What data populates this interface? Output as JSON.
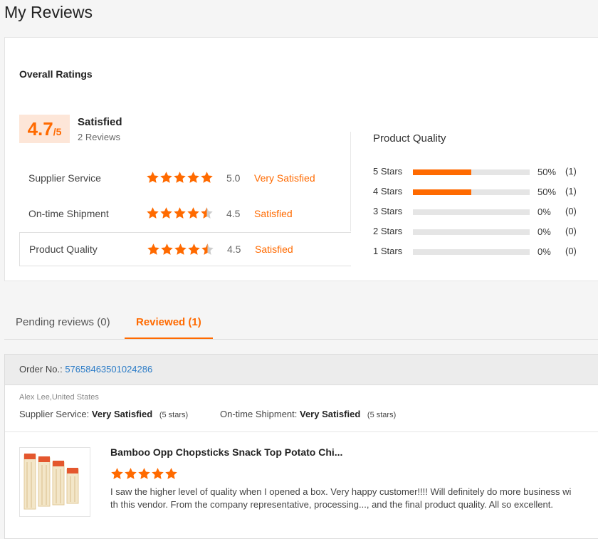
{
  "page": {
    "title": "My Reviews"
  },
  "overall": {
    "section_title": "Overall Ratings",
    "score": "4.7",
    "score_suffix": "/5",
    "summary_label": "Satisfied",
    "review_count": "2 Reviews"
  },
  "ratings": [
    {
      "label": "Supplier Service",
      "score": "5.0",
      "stars": 5.0,
      "verdict": "Very Satisfied"
    },
    {
      "label": "On-time Shipment",
      "score": "4.5",
      "stars": 4.5,
      "verdict": "Satisfied"
    },
    {
      "label": "Product Quality",
      "score": "4.5",
      "stars": 4.5,
      "verdict": "Satisfied"
    }
  ],
  "product_quality": {
    "title": "Product Quality",
    "distribution": [
      {
        "label": "5  Stars",
        "fraction": 0.5,
        "pct": "50%",
        "count": "(1)"
      },
      {
        "label": "4  Stars",
        "fraction": 0.5,
        "pct": "50%",
        "count": "(1)"
      },
      {
        "label": "3  Stars",
        "fraction": 0,
        "pct": "0%",
        "count": "(0)"
      },
      {
        "label": "2  Stars",
        "fraction": 0,
        "pct": "0%",
        "count": "(0)"
      },
      {
        "label": "1  Stars",
        "fraction": 0,
        "pct": "0%",
        "count": "(0)"
      }
    ]
  },
  "tabs": {
    "pending": "Pending reviews (0)",
    "reviewed": "Reviewed (1)"
  },
  "order": {
    "order_label": "Order No.:",
    "order_number": "57658463501024286",
    "reviewer": "Alex Lee,United States",
    "supplier_service_label": "Supplier Service:",
    "supplier_service_value": "Very Satisfied",
    "supplier_service_stars": "(5 stars)",
    "shipment_label": "On-time Shipment:",
    "shipment_value": "Very Satisfied",
    "shipment_stars": "(5 stars)",
    "product_name": "Bamboo Opp Chopsticks Snack Top Potato Chi...",
    "product_rating": 5,
    "review_text": "I saw the higher level of quality when I opened a box.  Very happy customer!!!! Will definitely do more business with this vendor.  From the company representative, processing..., and the final product quality. All so excellent."
  },
  "colors": {
    "accent": "#ff6a00",
    "star_empty": "#cccccc",
    "link": "#2c7cc7"
  }
}
